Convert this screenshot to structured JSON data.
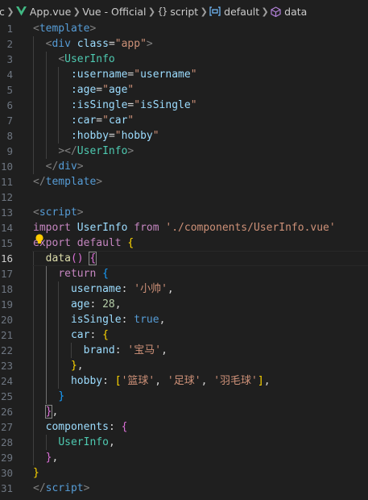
{
  "breadcrumb": {
    "folder": "c",
    "file": "App.vue",
    "language": "Vue - Official",
    "script": "script",
    "default_export": "default",
    "data_method": "data"
  },
  "colors": {
    "vue_logo": "#41b883",
    "symbol_blue": "#75beff",
    "symbol_purple": "#b180d7",
    "lightbulb": "#ffcc00"
  },
  "editor": {
    "current_line": 16,
    "lines": [
      {
        "n": "1",
        "t": [
          [
            "t-punct",
            "<"
          ],
          [
            "t-tag",
            "template"
          ],
          [
            "t-punct",
            ">"
          ]
        ]
      },
      {
        "n": "2",
        "t": [
          [
            "t-plain",
            "  "
          ],
          [
            "t-punct",
            "<"
          ],
          [
            "t-tag",
            "div"
          ],
          [
            "t-plain",
            " "
          ],
          [
            "t-attr",
            "class"
          ],
          [
            "t-plain",
            "="
          ],
          [
            "t-str",
            "\"app\""
          ],
          [
            "t-punct",
            ">"
          ]
        ]
      },
      {
        "n": "3",
        "t": [
          [
            "t-plain",
            "    "
          ],
          [
            "t-punct",
            "<"
          ],
          [
            "t-comp",
            "UserInfo"
          ]
        ]
      },
      {
        "n": "4",
        "t": [
          [
            "t-plain",
            "      "
          ],
          [
            "t-attr",
            ":username"
          ],
          [
            "t-plain",
            "="
          ],
          [
            "t-str",
            "\""
          ],
          [
            "t-var",
            "username"
          ],
          [
            "t-str",
            "\""
          ]
        ]
      },
      {
        "n": "5",
        "t": [
          [
            "t-plain",
            "      "
          ],
          [
            "t-attr",
            ":age"
          ],
          [
            "t-plain",
            "="
          ],
          [
            "t-str",
            "\""
          ],
          [
            "t-var",
            "age"
          ],
          [
            "t-str",
            "\""
          ]
        ]
      },
      {
        "n": "6",
        "t": [
          [
            "t-plain",
            "      "
          ],
          [
            "t-attr",
            ":isSingle"
          ],
          [
            "t-plain",
            "="
          ],
          [
            "t-str",
            "\""
          ],
          [
            "t-var",
            "isSingle"
          ],
          [
            "t-str",
            "\""
          ]
        ]
      },
      {
        "n": "7",
        "t": [
          [
            "t-plain",
            "      "
          ],
          [
            "t-attr",
            ":car"
          ],
          [
            "t-plain",
            "="
          ],
          [
            "t-str",
            "\""
          ],
          [
            "t-var",
            "car"
          ],
          [
            "t-str",
            "\""
          ]
        ]
      },
      {
        "n": "8",
        "t": [
          [
            "t-plain",
            "      "
          ],
          [
            "t-attr",
            ":hobby"
          ],
          [
            "t-plain",
            "="
          ],
          [
            "t-str",
            "\""
          ],
          [
            "t-var",
            "hobby"
          ],
          [
            "t-str",
            "\""
          ]
        ]
      },
      {
        "n": "9",
        "t": [
          [
            "t-plain",
            "    "
          ],
          [
            "t-punct",
            "></"
          ],
          [
            "t-comp",
            "UserInfo"
          ],
          [
            "t-punct",
            ">"
          ]
        ]
      },
      {
        "n": "10",
        "t": [
          [
            "t-plain",
            "  "
          ],
          [
            "t-punct",
            "</"
          ],
          [
            "t-tag",
            "div"
          ],
          [
            "t-punct",
            ">"
          ]
        ]
      },
      {
        "n": "11",
        "t": [
          [
            "t-punct",
            "</"
          ],
          [
            "t-tag",
            "template"
          ],
          [
            "t-punct",
            ">"
          ]
        ]
      },
      {
        "n": "12",
        "t": []
      },
      {
        "n": "13",
        "t": [
          [
            "t-punct",
            "<"
          ],
          [
            "t-tag",
            "script"
          ],
          [
            "t-punct",
            ">"
          ]
        ]
      },
      {
        "n": "14",
        "t": [
          [
            "t-kw",
            "import"
          ],
          [
            "t-plain",
            " "
          ],
          [
            "t-var",
            "UserInfo"
          ],
          [
            "t-plain",
            " "
          ],
          [
            "t-kw",
            "from"
          ],
          [
            "t-plain",
            " "
          ],
          [
            "t-str",
            "'./components/UserInfo.vue'"
          ]
        ]
      },
      {
        "n": "15",
        "t": [
          [
            "t-kw",
            "export"
          ],
          [
            "t-plain",
            " "
          ],
          [
            "t-kw",
            "default"
          ],
          [
            "t-plain",
            " "
          ],
          [
            "t-b1",
            "{"
          ]
        ]
      },
      {
        "n": "16",
        "t": [
          [
            "t-plain",
            "  "
          ],
          [
            "t-fn",
            "data"
          ],
          [
            "t-b2",
            "()"
          ],
          [
            "t-plain",
            " "
          ],
          [
            "t-b2 bmatch",
            "{"
          ]
        ]
      },
      {
        "n": "17",
        "t": [
          [
            "t-plain",
            "    "
          ],
          [
            "t-kw",
            "return"
          ],
          [
            "t-plain",
            " "
          ],
          [
            "t-b3",
            "{"
          ]
        ]
      },
      {
        "n": "18",
        "t": [
          [
            "t-plain",
            "      "
          ],
          [
            "t-var",
            "username"
          ],
          [
            "t-plain",
            ": "
          ],
          [
            "t-str",
            "'小帅'"
          ],
          [
            "t-plain",
            ","
          ]
        ]
      },
      {
        "n": "19",
        "t": [
          [
            "t-plain",
            "      "
          ],
          [
            "t-var",
            "age"
          ],
          [
            "t-plain",
            ": "
          ],
          [
            "t-num",
            "28"
          ],
          [
            "t-plain",
            ","
          ]
        ]
      },
      {
        "n": "20",
        "t": [
          [
            "t-plain",
            "      "
          ],
          [
            "t-var",
            "isSingle"
          ],
          [
            "t-plain",
            ": "
          ],
          [
            "t-kwb",
            "true"
          ],
          [
            "t-plain",
            ","
          ]
        ]
      },
      {
        "n": "21",
        "t": [
          [
            "t-plain",
            "      "
          ],
          [
            "t-var",
            "car"
          ],
          [
            "t-plain",
            ": "
          ],
          [
            "t-b1",
            "{"
          ]
        ]
      },
      {
        "n": "22",
        "t": [
          [
            "t-plain",
            "        "
          ],
          [
            "t-var",
            "brand"
          ],
          [
            "t-plain",
            ": "
          ],
          [
            "t-str",
            "'宝马'"
          ],
          [
            "t-plain",
            ","
          ]
        ]
      },
      {
        "n": "23",
        "t": [
          [
            "t-plain",
            "      "
          ],
          [
            "t-b1",
            "}"
          ],
          [
            "t-plain",
            ","
          ]
        ]
      },
      {
        "n": "24",
        "t": [
          [
            "t-plain",
            "      "
          ],
          [
            "t-var",
            "hobby"
          ],
          [
            "t-plain",
            ": "
          ],
          [
            "t-b1",
            "["
          ],
          [
            "t-str",
            "'篮球'"
          ],
          [
            "t-plain",
            ", "
          ],
          [
            "t-str",
            "'足球'"
          ],
          [
            "t-plain",
            ", "
          ],
          [
            "t-str",
            "'羽毛球'"
          ],
          [
            "t-b1",
            "]"
          ],
          [
            "t-plain",
            ","
          ]
        ]
      },
      {
        "n": "25",
        "t": [
          [
            "t-plain",
            "    "
          ],
          [
            "t-b3",
            "}"
          ]
        ]
      },
      {
        "n": "26",
        "t": [
          [
            "t-plain",
            "  "
          ],
          [
            "t-b2 bmatch",
            "}"
          ],
          [
            "t-plain",
            ","
          ]
        ]
      },
      {
        "n": "27",
        "t": [
          [
            "t-plain",
            "  "
          ],
          [
            "t-var",
            "components"
          ],
          [
            "t-plain",
            ": "
          ],
          [
            "t-b2",
            "{"
          ]
        ]
      },
      {
        "n": "28",
        "t": [
          [
            "t-plain",
            "    "
          ],
          [
            "t-comp",
            "UserInfo"
          ],
          [
            "t-plain",
            ","
          ]
        ]
      },
      {
        "n": "29",
        "t": [
          [
            "t-plain",
            "  "
          ],
          [
            "t-b2",
            "}"
          ],
          [
            "t-plain",
            ","
          ]
        ]
      },
      {
        "n": "30",
        "t": [
          [
            "t-b1",
            "}"
          ]
        ]
      },
      {
        "n": "31",
        "t": [
          [
            "t-punct",
            "</"
          ],
          [
            "t-tag",
            "script"
          ],
          [
            "t-punct",
            ">"
          ]
        ]
      }
    ]
  }
}
